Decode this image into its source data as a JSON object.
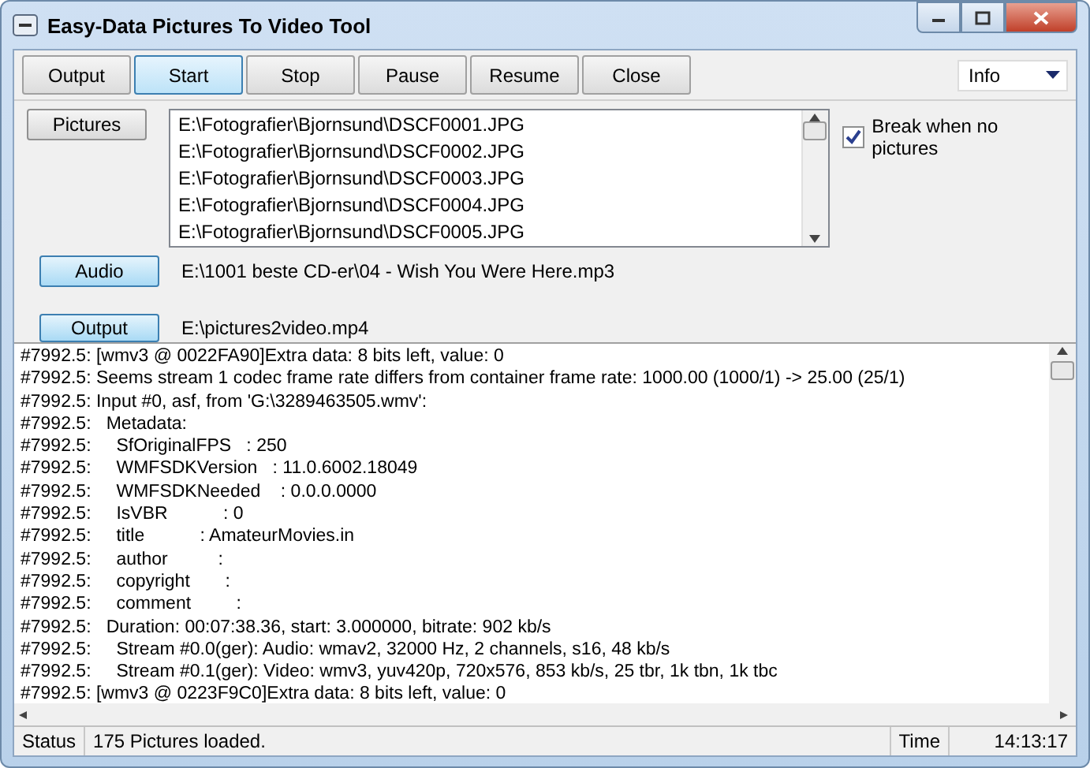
{
  "window": {
    "title": "Easy-Data Pictures To Video Tool"
  },
  "toolbar": {
    "buttons": [
      {
        "label": "Output",
        "selected": false
      },
      {
        "label": "Start",
        "selected": true
      },
      {
        "label": "Stop",
        "selected": false
      },
      {
        "label": "Pause",
        "selected": false
      },
      {
        "label": "Resume",
        "selected": false
      },
      {
        "label": "Close",
        "selected": false
      }
    ],
    "level_select": {
      "value": "Info"
    }
  },
  "pictures": {
    "button": "Pictures",
    "files": [
      "E:\\Fotografier\\Bjornsund\\DSCF0001.JPG",
      "E:\\Fotografier\\Bjornsund\\DSCF0002.JPG",
      "E:\\Fotografier\\Bjornsund\\DSCF0003.JPG",
      "E:\\Fotografier\\Bjornsund\\DSCF0004.JPG",
      "E:\\Fotografier\\Bjornsund\\DSCF0005.JPG"
    ],
    "break_checkbox": {
      "label": "Break when no pictures",
      "checked": true
    }
  },
  "audio": {
    "button": "Audio",
    "path": "E:\\1001 beste CD-er\\04 - Wish You Were Here.mp3"
  },
  "output": {
    "button": "Output",
    "path": "E:\\pictures2video.mp4"
  },
  "log": [
    "#7992.5: [wmv3 @ 0022FA90]Extra data: 8 bits left, value: 0",
    "#7992.5: Seems stream 1 codec frame rate differs from container frame rate: 1000.00 (1000/1) -> 25.00 (25/1)",
    "#7992.5: Input #0, asf, from 'G:\\3289463505.wmv':",
    "#7992.5:   Metadata:",
    "#7992.5:     SfOriginalFPS   : 250",
    "#7992.5:     WMFSDKVersion   : 11.0.6002.18049",
    "#7992.5:     WMFSDKNeeded    : 0.0.0.0000",
    "#7992.5:     IsVBR           : 0",
    "#7992.5:     title           : AmateurMovies.in",
    "#7992.5:     author          :",
    "#7992.5:     copyright       :",
    "#7992.5:     comment         :",
    "#7992.5:   Duration: 00:07:38.36, start: 3.000000, bitrate: 902 kb/s",
    "#7992.5:     Stream #0.0(ger): Audio: wmav2, 32000 Hz, 2 channels, s16, 48 kb/s",
    "#7992.5:     Stream #0.1(ger): Video: wmv3, yuv420p, 720x576, 853 kb/s, 25 tbr, 1k tbn, 1k tbc",
    "#7992.5: [wmv3 @ 0223F9C0]Extra data: 8 bits left, value: 0"
  ],
  "status_bar": {
    "status_label": "Status",
    "status": "175 Pictures loaded.",
    "time_label": "Time",
    "time": "14:13:17"
  }
}
